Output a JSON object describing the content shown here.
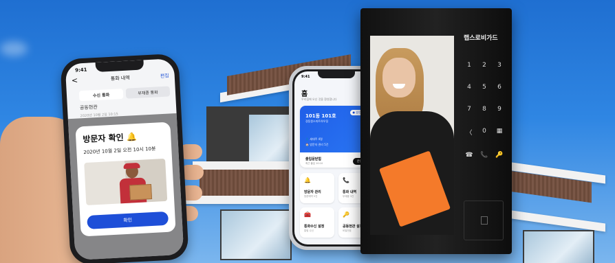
{
  "left_phone": {
    "time": "9:41",
    "header_title": "통화 내역",
    "back": "<",
    "edit": "편집",
    "tabs": [
      {
        "label": "수신 통화",
        "active": true
      },
      {
        "label": "부재중 통화",
        "active": false
      }
    ],
    "entry": {
      "title": "공동현관",
      "subtitle": "2020년 10월 2일 10:15"
    },
    "modal": {
      "title": "방문자 확인 🔔",
      "datetime": "2020년 10월 2일 오전 10시 10분",
      "confirm_button": "확인"
    }
  },
  "center_phone": {
    "time": "9:41",
    "title": "홈",
    "subtitle": "우리집에 오신 것을 환영합니다",
    "avatar_emoji": "😀",
    "home_card": {
      "unit": "101동 101호",
      "address": "경동원스마트하우징",
      "status": "● 승인완료",
      "line1": "👤 세대주 4명",
      "line2": "🏠 방문자 관리 5건",
      "door_label": "출입문닫힘",
      "door_sub": "최근 출입 10:10",
      "open_button": "문열기"
    },
    "tiles": [
      {
        "icon": "🔔",
        "label": "방문자 관리",
        "sub": "방문예약 5건"
      },
      {
        "icon": "📞",
        "label": "통화 내역",
        "sub": "부재중 3건"
      },
      {
        "icon": "🧰",
        "label": "통화수신 설정",
        "sub": "알림 수신"
      },
      {
        "icon": "🔑",
        "label": "공동현관 설정",
        "sub": "비밀번호"
      }
    ]
  },
  "door_panel": {
    "logo": "랩스로비가드",
    "keys": [
      "1",
      "2",
      "3",
      "4",
      "5",
      "6",
      "7",
      "8",
      "9",
      "〈",
      "0",
      "▦",
      "☎",
      "📞",
      "🔑"
    ]
  }
}
